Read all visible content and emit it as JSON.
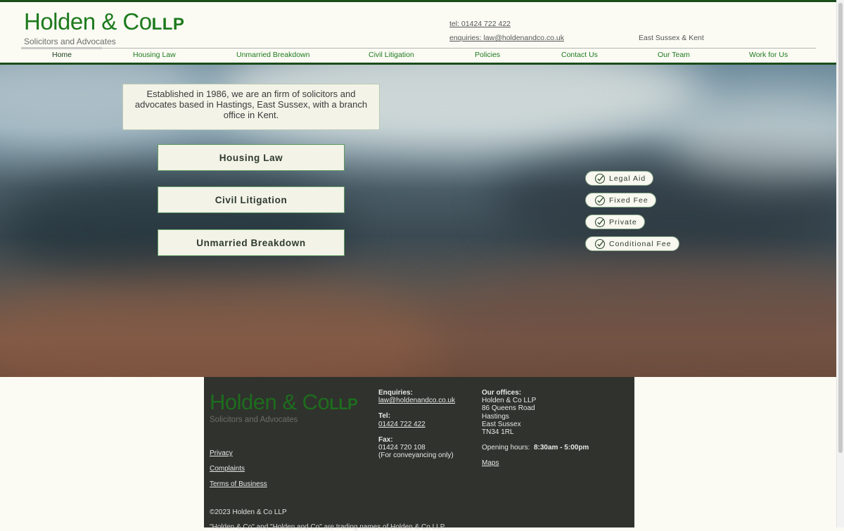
{
  "brand": {
    "name": "Holden & Co",
    "suffix": "LLP",
    "tagline": "Solicitors and Advocates"
  },
  "header": {
    "tel_link": "tel: 01424 722 422",
    "enquiries_link": "enquiries: law@holdenandco.co.uk",
    "region": "East Sussex & Kent"
  },
  "nav": {
    "items": [
      {
        "label": "Home",
        "active": true
      },
      {
        "label": "Housing Law"
      },
      {
        "label": "Unmarried Breakdown"
      },
      {
        "label": "Civil Litigation"
      },
      {
        "label": "Policies"
      },
      {
        "label": "Contact Us"
      },
      {
        "label": "Our Team"
      },
      {
        "label": "Work for Us"
      }
    ]
  },
  "hero": {
    "intro": "Established in 1986, we are an firm of solicitors and advocates based in Hastings, East Sussex, with a branch office in Kent.",
    "services": [
      "Housing Law",
      "Civil Litigation",
      "Unmarried Breakdown"
    ],
    "funding": [
      "Legal Aid",
      "Fixed Fee",
      "Private",
      "Conditional Fee"
    ]
  },
  "footer": {
    "links": [
      "Privacy",
      "Complaints",
      "Terms of Business"
    ],
    "copyright": "©2023 Holden & Co LLP",
    "trading_note": "\"Holden & Co\" and \"Holden and Co\" are trading names of Holden & Co LLP",
    "enquiries_label": "Enquiries:",
    "enquiries_email": "law@holdenandco.co.uk",
    "tel_label": "Tel:",
    "tel_number": "01424 722 422",
    "fax_label": "Fax:",
    "fax_number": "01424 720 108",
    "fax_note": "(For conveyancing only)",
    "offices_label": "Our offices:",
    "address": [
      "Holden & Co LLP",
      "86 Queens Road",
      "Hastings",
      "East Sussex",
      "TN34 1RL"
    ],
    "hours_label": "Opening hours:",
    "hours_value": "8:30am - 5:00pm",
    "maps_link": "Maps"
  },
  "colors": {
    "brand_green": "#1d7a1d",
    "dark_green_rule": "#1a4d1a",
    "footer_bg": "#30322d",
    "panel_bg": "#f3f3e8"
  },
  "icons": {
    "funding_check": "check-circle-icon"
  }
}
